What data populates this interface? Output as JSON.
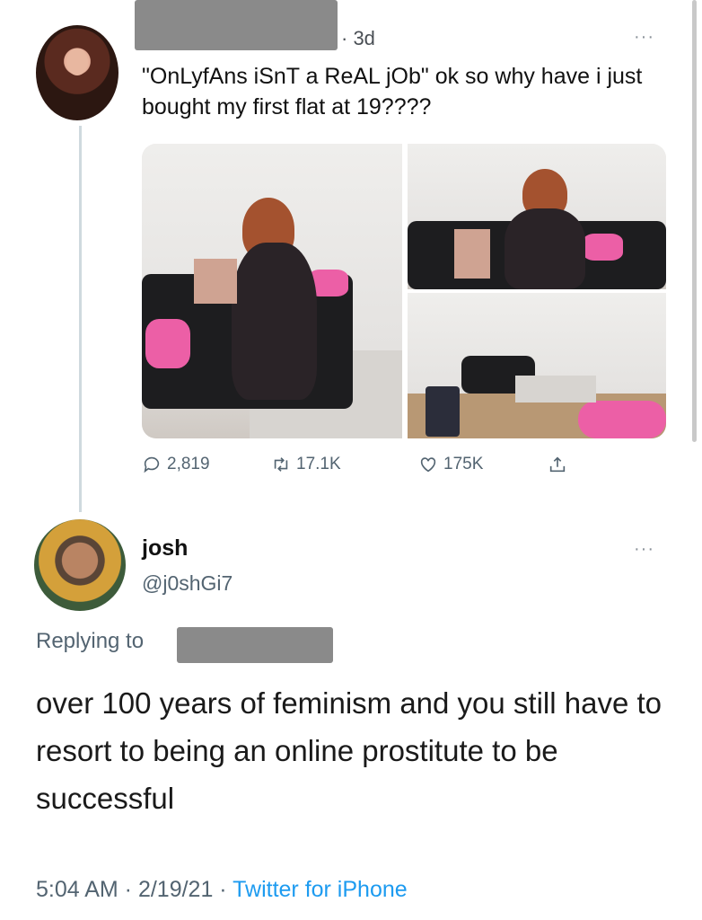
{
  "tweet": {
    "time_separator": "· 3d",
    "more_label": "···",
    "text": "\"OnLyfAns iSnT a ReAL jOb\" ok so why have i just bought my first flat at 19????",
    "stats": {
      "replies": "2,819",
      "retweets": "17.1K",
      "likes": "175K"
    },
    "icons": [
      "reply-icon",
      "retweet-icon",
      "like-icon",
      "share-icon"
    ]
  },
  "reply": {
    "display_name": "josh",
    "handle": "@j0shGi7",
    "more_label": "···",
    "replying_to_label": "Replying to",
    "text": "over 100 years of feminism and you still have to resort to being an online prostitute to be successful",
    "timestamp": "5:04 AM · 2/19/21 · ",
    "source": "Twitter for iPhone"
  },
  "colors": {
    "accent": "#1d9bf0",
    "secondary_text": "#536471",
    "redaction": "#8a8a8a"
  }
}
